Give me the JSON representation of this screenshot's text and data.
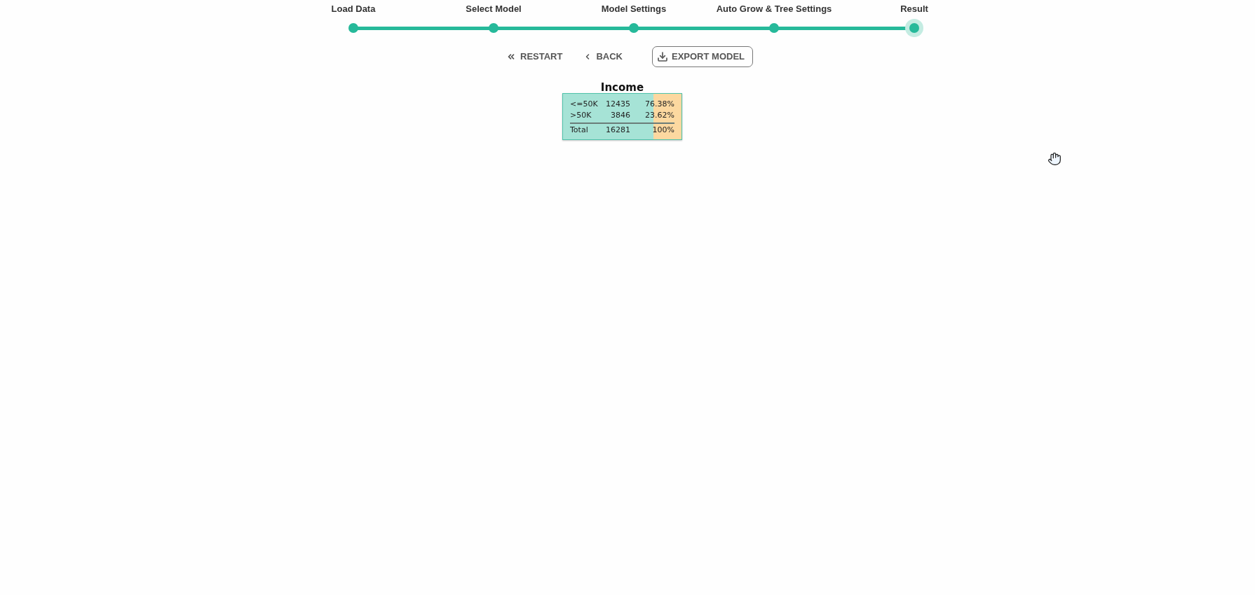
{
  "stepper": {
    "steps": [
      {
        "label": "Load Data",
        "selected": false
      },
      {
        "label": "Select Model",
        "selected": false
      },
      {
        "label": "Model Settings",
        "selected": false
      },
      {
        "label": "Auto Grow & Tree Settings",
        "selected": false
      },
      {
        "label": "Result",
        "selected": true
      }
    ]
  },
  "actions": [
    {
      "kind": "restart",
      "label": "RESTART"
    },
    {
      "kind": "back",
      "label": "BACK"
    },
    {
      "kind": "export",
      "label": "EXPORT MODEL"
    }
  ],
  "tree": {
    "nodes": [
      {
        "title": "Income",
        "classes": [
          {
            "label": "<=50K",
            "count": "12435",
            "percent": "76.38%",
            "color": "#a6e3d6",
            "level": 0.7638
          },
          {
            "label": ">50K",
            "count": "3846",
            "percent": "23.62%",
            "color": "#fcd8a0",
            "level": 0.2362
          }
        ],
        "total": {
          "label": "Total",
          "count": "16281",
          "percent": "100%"
        }
      }
    ]
  }
}
